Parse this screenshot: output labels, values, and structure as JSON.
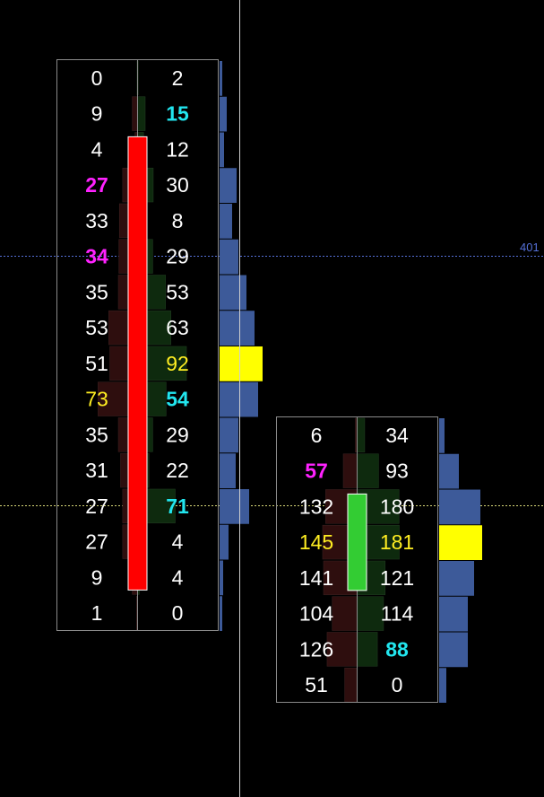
{
  "price_label": "401",
  "colors": {
    "background": "#000000",
    "text": "#ffffff",
    "bold_bid": "#ff22ff",
    "bold_ask": "#22e5ee",
    "poc_text": "#ffee22",
    "profile": "#3d5a99",
    "poc_bar": "#ffff00",
    "down_candle": "#ff0000",
    "up_candle": "#33cc33",
    "cell_green": "#0e2a0e",
    "cell_red": "#2e0e0e",
    "box_border": "#8a8a8a",
    "price_line": "#5570d8",
    "current_line": "#d8d878",
    "cursor_line": "#cfcfcf"
  },
  "chart_data": [
    {
      "type": "footprint",
      "candle": "down",
      "rows": [
        {
          "bid": "0",
          "ask": "2",
          "bid_style": "",
          "ask_style": ""
        },
        {
          "bid": "9",
          "ask": "15",
          "bid_style": "",
          "ask_style": "bold_ask"
        },
        {
          "bid": "4",
          "ask": "12",
          "bid_style": "",
          "ask_style": ""
        },
        {
          "bid": "27",
          "ask": "30",
          "bid_style": "bold_bid",
          "ask_style": ""
        },
        {
          "bid": "33",
          "ask": "8",
          "bid_style": "",
          "ask_style": ""
        },
        {
          "bid": "34",
          "ask": "29",
          "bid_style": "bold_bid",
          "ask_style": ""
        },
        {
          "bid": "35",
          "ask": "53",
          "bid_style": "",
          "ask_style": ""
        },
        {
          "bid": "53",
          "ask": "63",
          "bid_style": "",
          "ask_style": ""
        },
        {
          "bid": "51",
          "ask": "92",
          "bid_style": "",
          "ask_style": "poc"
        },
        {
          "bid": "73",
          "ask": "54",
          "bid_style": "poc",
          "ask_style": "bold_ask"
        },
        {
          "bid": "35",
          "ask": "29",
          "bid_style": "",
          "ask_style": ""
        },
        {
          "bid": "31",
          "ask": "22",
          "bid_style": "",
          "ask_style": ""
        },
        {
          "bid": "27",
          "ask": "71",
          "bid_style": "",
          "ask_style": "bold_ask"
        },
        {
          "bid": "27",
          "ask": "4",
          "bid_style": "",
          "ask_style": ""
        },
        {
          "bid": "9",
          "ask": "4",
          "bid_style": "",
          "ask_style": ""
        },
        {
          "bid": "1",
          "ask": "0",
          "bid_style": "",
          "ask_style": ""
        }
      ],
      "poc_row": 8,
      "candle_rows": [
        2,
        14
      ]
    },
    {
      "type": "footprint",
      "candle": "up",
      "rows": [
        {
          "bid": "6",
          "ask": "34",
          "bid_style": "",
          "ask_style": ""
        },
        {
          "bid": "57",
          "ask": "93",
          "bid_style": "bold_bid",
          "ask_style": ""
        },
        {
          "bid": "132",
          "ask": "180",
          "bid_style": "",
          "ask_style": ""
        },
        {
          "bid": "145",
          "ask": "181",
          "bid_style": "poc",
          "ask_style": "poc"
        },
        {
          "bid": "141",
          "ask": "121",
          "bid_style": "",
          "ask_style": ""
        },
        {
          "bid": "104",
          "ask": "114",
          "bid_style": "",
          "ask_style": ""
        },
        {
          "bid": "126",
          "ask": "88",
          "bid_style": "",
          "ask_style": "bold_ask"
        },
        {
          "bid": "51",
          "ask": "0",
          "bid_style": "",
          "ask_style": ""
        }
      ],
      "poc_row": 3,
      "candle_rows": [
        2,
        4
      ]
    }
  ]
}
